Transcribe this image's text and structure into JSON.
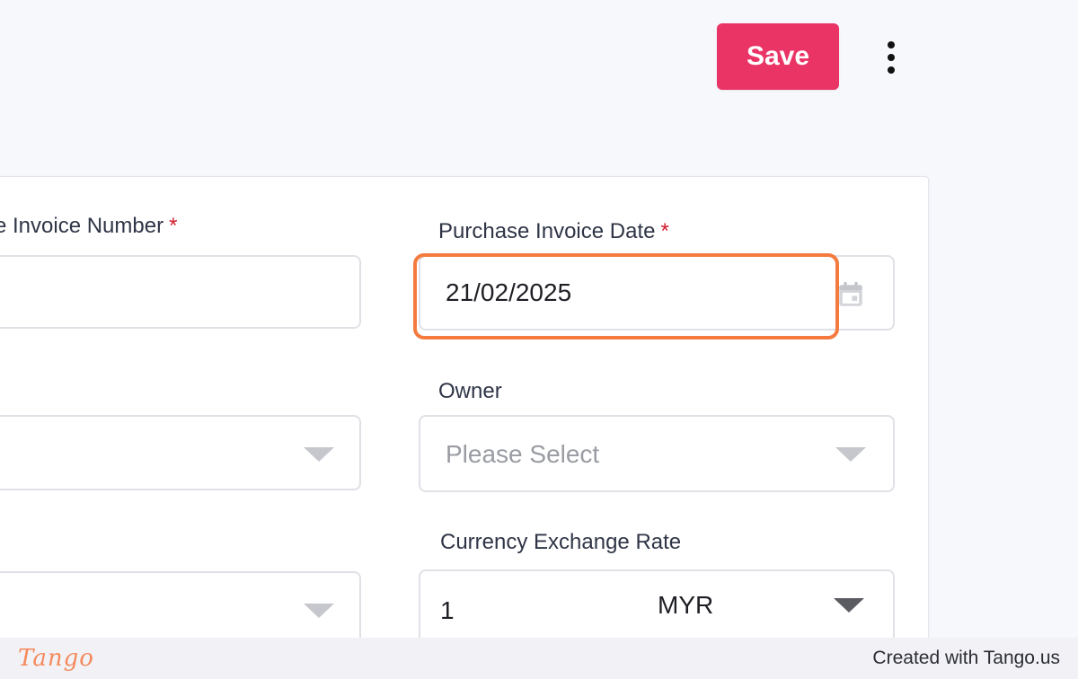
{
  "toolbar": {
    "save_label": "Save",
    "more_icon": "vertical-dots-icon"
  },
  "form": {
    "invoice_number": {
      "label": "e Invoice Number",
      "required_mark": "*",
      "value": ""
    },
    "invoice_date": {
      "label": "Purchase Invoice Date",
      "required_mark": "*",
      "value": "21/02/2025",
      "icon": "calendar-icon"
    },
    "left_select_1": {
      "value": ""
    },
    "owner": {
      "label": "Owner",
      "placeholder": "Please Select"
    },
    "left_select_2": {
      "value": ""
    },
    "currency_exchange_rate": {
      "label": "Currency Exchange Rate",
      "value": "1",
      "currency": "MYR"
    }
  },
  "footer": {
    "logo_text": "Tango",
    "credit": "Created with Tango.us"
  },
  "colors": {
    "accent": "#ea3465",
    "highlight": "#f47a3f",
    "background": "#f7f8fc"
  }
}
